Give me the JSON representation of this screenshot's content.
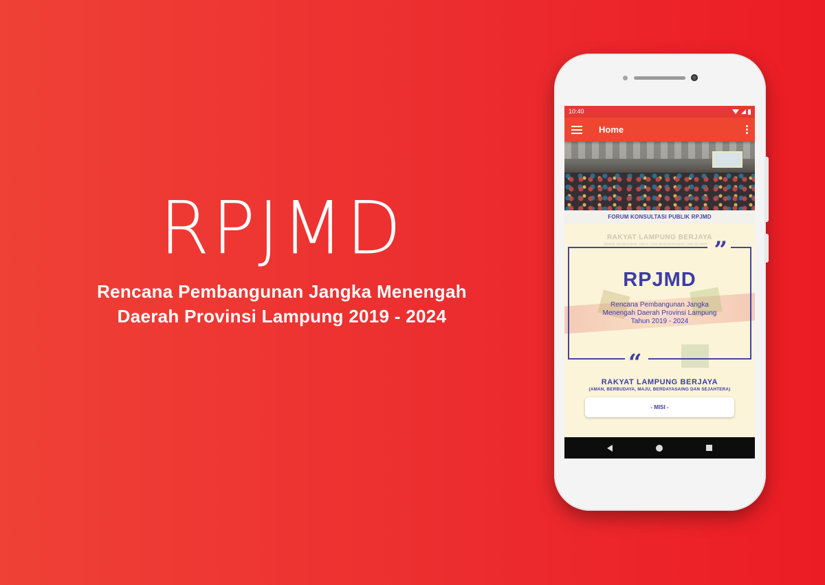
{
  "promo": {
    "title": "RPJMD",
    "subtitle_line1": "Rencana Pembangunan Jangka Menengah",
    "subtitle_line2": "Daerah Provinsi Lampung 2019 - 2024"
  },
  "status_bar": {
    "time": "10:40"
  },
  "app_bar": {
    "title": "Home"
  },
  "banner": {
    "caption": "FORUM KONSULTASI PUBLIK RPJMD"
  },
  "vision_card": {
    "faded_title": "RAKYAT LAMPUNG BERJAYA",
    "faded_subtitle": "(AMAN, BERBUDAYA, MAJU, DAN BERDAYASAING DAN SEJAHTERA)",
    "quote_close": "”",
    "quote_open": "“",
    "title": "RPJMD",
    "description_line1": "Rencana Pembangunan Jangka",
    "description_line2": "Menengah Daerah Provinsi Lampung",
    "description_line3": "Tahun 2019 - 2024",
    "motto": "RAKYAT LAMPUNG BERJAYA",
    "motto_sub": "(AMAN, BERBUDAYA, MAJU, BERDAYASAING DAN SEJAHTERA)"
  },
  "misi_button": {
    "label": "- MISI -"
  },
  "colors": {
    "background": "#ec2b2e",
    "app_bar": "#ee4630",
    "accent_text": "#3b3ca5",
    "card_background": "#fbf4d8"
  },
  "icons": {
    "menu": "hamburger-icon",
    "more": "more-vert-icon",
    "back": "triangle-back-icon",
    "home": "circle-home-icon",
    "recent": "square-recent-icon"
  }
}
